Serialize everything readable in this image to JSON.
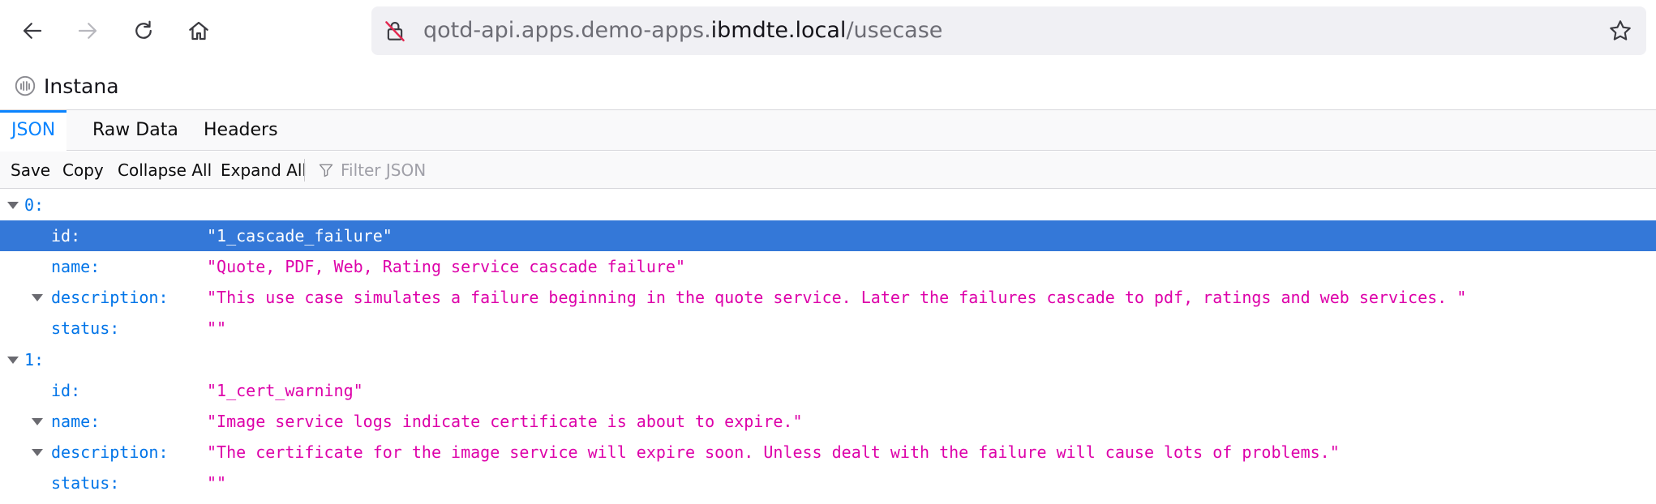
{
  "browser": {
    "url_prefix": "qotd-api.apps.demo-apps.",
    "url_domain": "ibmdte.local",
    "url_path": "/usecase",
    "nav_icons": [
      "back-arrow-icon",
      "forward-arrow-icon",
      "reload-icon",
      "home-icon"
    ]
  },
  "bookmarks": [
    {
      "label": "Instana",
      "icon": "instana-icon"
    }
  ],
  "viewer": {
    "tabs": [
      {
        "label": "JSON",
        "selected": true
      },
      {
        "label": "Raw Data",
        "selected": false
      },
      {
        "label": "Headers",
        "selected": false
      }
    ],
    "toolbar": {
      "save": "Save",
      "copy": "Copy",
      "collapse_all": "Collapse All",
      "expand_all": "Expand All",
      "filter_placeholder": "Filter JSON"
    }
  },
  "tree": {
    "items": [
      {
        "index": "0:",
        "fields": [
          {
            "key": "id:",
            "value": "\"1_cascade_failure\"",
            "expandable": false,
            "selected": true
          },
          {
            "key": "name:",
            "value": "\"Quote, PDF, Web, Rating service cascade failure\"",
            "expandable": false,
            "selected": false
          },
          {
            "key": "description:",
            "value": "\"This use case simulates a failure beginning in the quote service.  Later the failures cascade to pdf, ratings and web services.  \"",
            "expandable": true,
            "selected": false
          },
          {
            "key": "status:",
            "value": "\"\"",
            "expandable": false,
            "selected": false
          }
        ]
      },
      {
        "index": "1:",
        "fields": [
          {
            "key": "id:",
            "value": "\"1_cert_warning\"",
            "expandable": false,
            "selected": false
          },
          {
            "key": "name:",
            "value": "\"Image service logs indicate certificate is about to expire.\"",
            "expandable": true,
            "selected": false
          },
          {
            "key": "description:",
            "value": "\"The certificate for the image service will expire soon. Unless dealt with the failure will cause lots of problems.\"",
            "expandable": true,
            "selected": false
          },
          {
            "key": "status:",
            "value": "\"\"",
            "expandable": false,
            "selected": false
          }
        ]
      }
    ]
  },
  "colors": {
    "accent": "#0a84ff",
    "selection": "#3478d8",
    "json_key": "#0074e8",
    "json_string": "#dd00a9"
  }
}
